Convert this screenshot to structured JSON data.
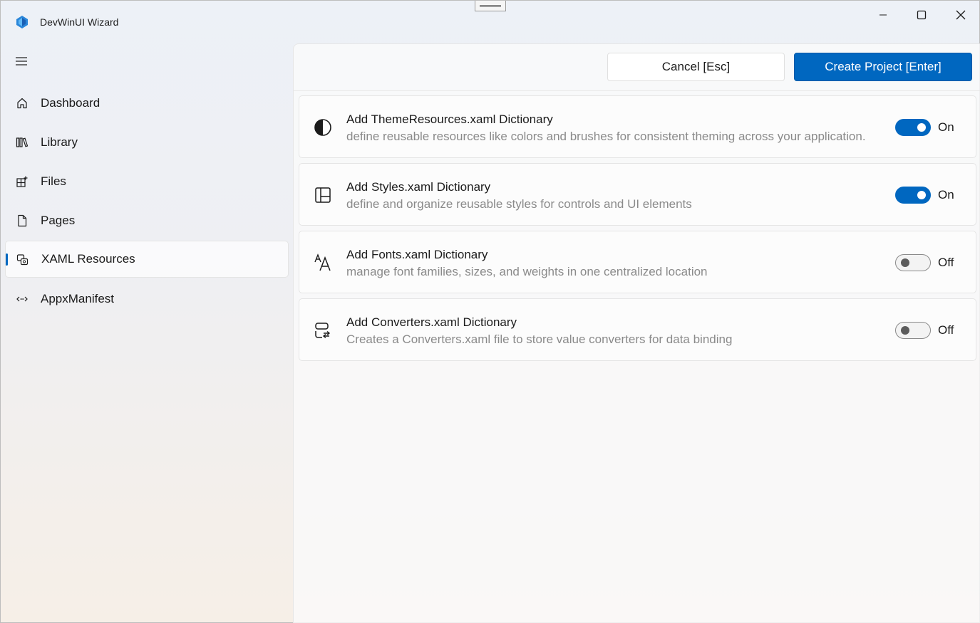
{
  "window": {
    "title": "DevWinUI Wizard",
    "icon": "devwinui-logo-icon",
    "controls": [
      "minimize-icon",
      "maximize-icon",
      "close-icon"
    ]
  },
  "sidebar": {
    "menu_icon": "hamburger-icon",
    "items": [
      {
        "label": "Dashboard",
        "icon": "home-icon",
        "selected": false
      },
      {
        "label": "Library",
        "icon": "library-icon",
        "selected": false
      },
      {
        "label": "Files",
        "icon": "files-icon",
        "selected": false
      },
      {
        "label": "Pages",
        "icon": "page-icon",
        "selected": false
      },
      {
        "label": "XAML Resources",
        "icon": "resources-icon",
        "selected": true
      },
      {
        "label": "AppxManifest",
        "icon": "manifest-icon",
        "selected": false
      }
    ]
  },
  "commands": {
    "cancel_label": "Cancel [Esc]",
    "create_label": "Create Project [Enter]"
  },
  "options": [
    {
      "title": "Add ThemeResources.xaml Dictionary",
      "description": "define reusable resources like colors and brushes for consistent theming across your application.",
      "icon": "contrast-icon",
      "enabled": true,
      "state_label": "On"
    },
    {
      "title": "Add Styles.xaml Dictionary",
      "description": "define and organize reusable styles for controls and UI elements",
      "icon": "layout-panel-icon",
      "enabled": true,
      "state_label": "On"
    },
    {
      "title": "Add Fonts.xaml Dictionary",
      "description": "manage font families, sizes, and weights in one centralized location",
      "icon": "font-icon",
      "enabled": false,
      "state_label": "Off"
    },
    {
      "title": "Add Converters.xaml Dictionary",
      "description": "Creates a Converters.xaml file to store value converters for data binding",
      "icon": "converter-icon",
      "enabled": false,
      "state_label": "Off"
    }
  ],
  "colors": {
    "accent": "#0067c0",
    "description_text": "#8a8a8a"
  }
}
